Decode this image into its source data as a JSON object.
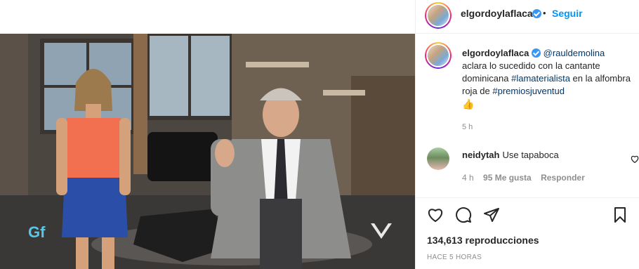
{
  "post": {
    "account": "elgordoylaflaca",
    "follow_label": "Seguir",
    "separator": "•",
    "caption": {
      "username": "elgordoylaflaca",
      "mention": "@rauldemolina",
      "text_1": " aclara lo sucedido con la cantante dominicana ",
      "hashtag_1": "#lamaterialista",
      "text_2": " en la alfombra roja de ",
      "hashtag_2": "#premiosjuventud",
      "emoji": "👍",
      "time": "5 h"
    },
    "comment": {
      "username": "neidytah",
      "text": "Use tapaboca",
      "time": "4 h",
      "likes": "95 Me gusta",
      "reply_label": "Responder"
    },
    "views": "134,613 reproducciones",
    "posted_ago": "HACE 5 HORAS"
  },
  "icons": [
    "verified-badge-icon",
    "more-options-icon",
    "heart-icon",
    "comment-icon",
    "share-icon",
    "bookmark-icon",
    "like-comment-icon"
  ],
  "colors": {
    "link": "#00376b",
    "follow": "#0095f6",
    "verified": "#3897f0",
    "meta": "#8e8e8e"
  }
}
